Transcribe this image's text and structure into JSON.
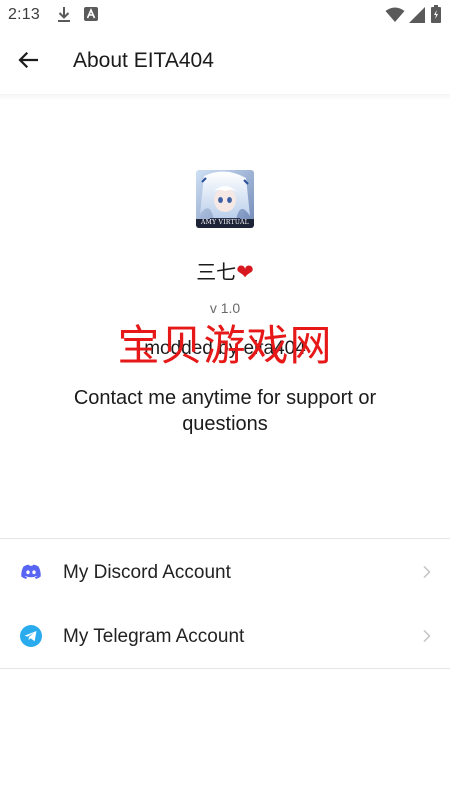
{
  "status_bar": {
    "time": "2:13",
    "icons": [
      "download-icon",
      "app-notification-icon",
      "wifi-icon",
      "signal-icon",
      "battery-icon"
    ]
  },
  "app_bar": {
    "back_icon": "arrow-left-icon",
    "title": "About EITA404"
  },
  "about": {
    "avatar_caption": "AMY VIRTUAL",
    "name": "三七",
    "name_emoji": "❤",
    "version": "v 1.0",
    "modded_by": "modded by eita404",
    "contact": "Contact me anytime for support or questions"
  },
  "watermark": "宝贝游戏网",
  "links": [
    {
      "label": "My Discord Account",
      "icon": "discord-icon",
      "icon_color": "#5865F2"
    },
    {
      "label": "My Telegram Account",
      "icon": "telegram-icon",
      "icon_color": "#2AABEE"
    }
  ],
  "colors": {
    "accent_heart": "#d7191f",
    "watermark": "#e61818",
    "divider": "#e6e6e6"
  }
}
